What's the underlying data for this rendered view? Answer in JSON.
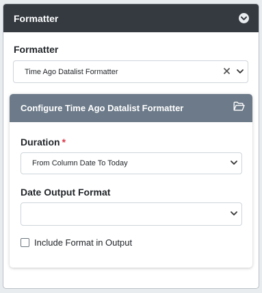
{
  "panel": {
    "title": "Formatter",
    "collapse_icon": "chevron-down-circle-icon"
  },
  "formatter_field": {
    "label": "Formatter",
    "selected": "Time Ago Datalist Formatter",
    "clear_icon": "close-icon",
    "dropdown_icon": "chevron-down-icon"
  },
  "config_card": {
    "title": "Configure Time Ago Datalist Formatter",
    "header_icon": "folder-open-icon",
    "duration": {
      "label": "Duration",
      "required_mark": "*",
      "selected": "From Column Date To Today"
    },
    "date_output_format": {
      "label": "Date Output Format",
      "selected": ""
    },
    "include_format": {
      "label": "Include Format in Output",
      "checked": false
    }
  },
  "colors": {
    "header_dark": "#343a40",
    "sub_header": "#6c7a89",
    "required": "#dc3545",
    "background": "#e9ecef"
  }
}
